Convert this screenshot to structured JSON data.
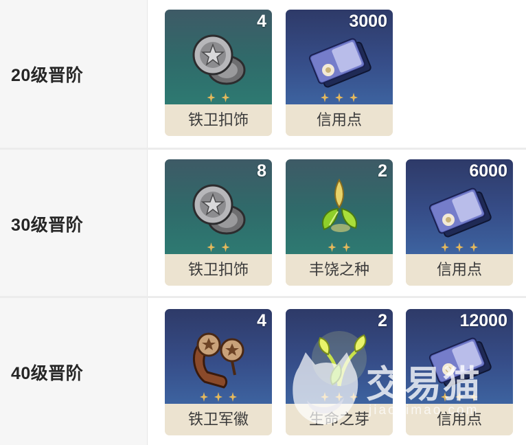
{
  "rows": [
    {
      "label": "20级晋阶",
      "items": [
        {
          "name": "铁卫扣饰",
          "qty": "4",
          "icon": "iron-guard-buckle-icon",
          "bg": "teal",
          "stars": 2
        },
        {
          "name": "信用点",
          "qty": "3000",
          "icon": "credit-card-icon",
          "bg": "blue",
          "stars": 3
        }
      ]
    },
    {
      "label": "30级晋阶",
      "items": [
        {
          "name": "铁卫扣饰",
          "qty": "8",
          "icon": "iron-guard-buckle-icon",
          "bg": "teal",
          "stars": 2
        },
        {
          "name": "丰饶之种",
          "qty": "2",
          "icon": "abundance-seed-icon",
          "bg": "teal",
          "stars": 2
        },
        {
          "name": "信用点",
          "qty": "6000",
          "icon": "credit-card-icon",
          "bg": "blue",
          "stars": 3
        }
      ]
    },
    {
      "label": "40级晋阶",
      "items": [
        {
          "name": "铁卫军徽",
          "qty": "4",
          "icon": "iron-guard-emblem-icon",
          "bg": "blue",
          "stars": 3
        },
        {
          "name": "生命之芽",
          "qty": "2",
          "icon": "life-sprout-icon",
          "bg": "blue",
          "stars": 3
        },
        {
          "name": "信用点",
          "qty": "12000",
          "icon": "credit-card-icon",
          "bg": "blue",
          "stars": 3
        }
      ]
    }
  ],
  "watermark": {
    "logo_text": "交易猫",
    "url_text": "jiaoyimao.com"
  }
}
